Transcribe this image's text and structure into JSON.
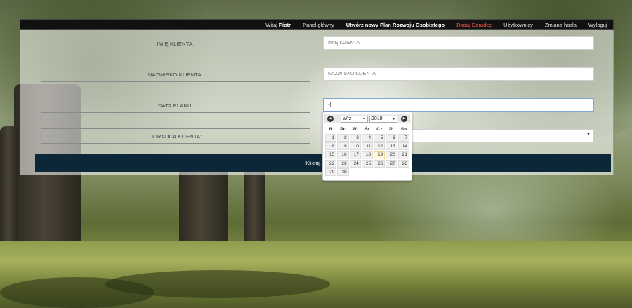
{
  "nav": {
    "items": [
      {
        "prefix": "Witaj ",
        "name": "Piotr"
      },
      {
        "label": "Panel główny"
      },
      {
        "label": "Utwórz nowy Plan Rozwoju Osobistego"
      },
      {
        "label": "Dodaj Doradcę"
      },
      {
        "label": "Użytkownicy"
      },
      {
        "label": "Zmiana hasła"
      },
      {
        "label": "Wyloguj"
      }
    ]
  },
  "form": {
    "first_name": {
      "label": "IMIĘ KLIENTA:",
      "placeholder": "IMIĘ KLIENTA"
    },
    "last_name": {
      "label": "NAZWISKO KLIENTA:",
      "placeholder": "NAZWISKO KLIENTA"
    },
    "plan_date": {
      "label": "DATA PLANU:",
      "value": "-|"
    },
    "advisor": {
      "label": "DORADCA KLIENTA:",
      "value": ""
    },
    "submit_label": "Kliknij, aby utw"
  },
  "datepicker": {
    "month": "Wrz",
    "year": "2019",
    "weekdays": [
      "N",
      "Pn",
      "Wt",
      "Śr",
      "Cz",
      "Pt",
      "So"
    ],
    "weeks": [
      [
        "1",
        "2",
        "3",
        "4",
        "5",
        "6",
        "7"
      ],
      [
        "8",
        "9",
        "10",
        "11",
        "12",
        "13",
        "14"
      ],
      [
        "15",
        "16",
        "17",
        "18",
        "19",
        "20",
        "21"
      ],
      [
        "22",
        "23",
        "24",
        "25",
        "26",
        "27",
        "28"
      ],
      [
        "29",
        "30",
        "",
        "",
        "",
        "",
        ""
      ]
    ],
    "highlighted_day": "19"
  }
}
